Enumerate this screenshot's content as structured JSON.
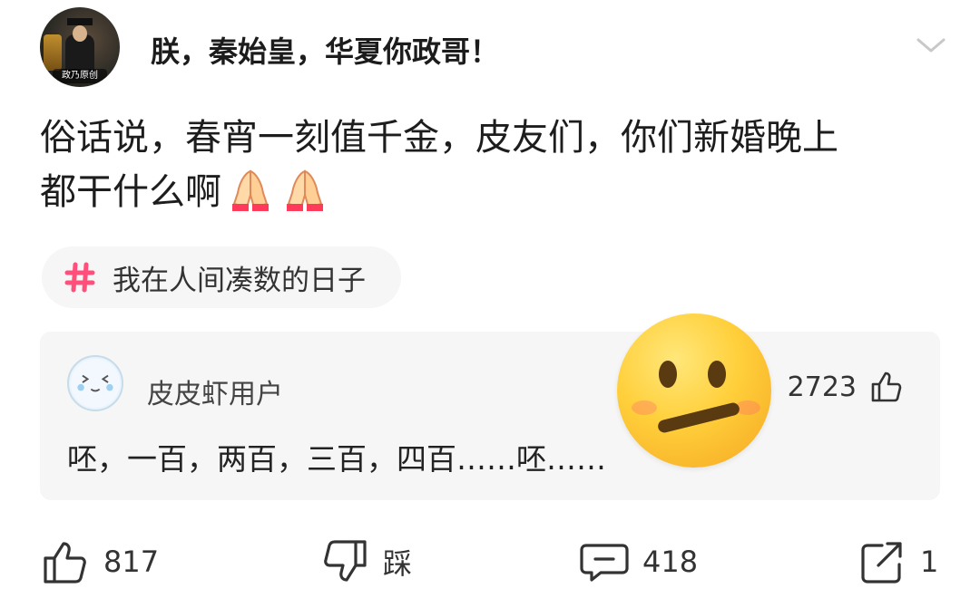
{
  "post": {
    "author": "朕，秦始皇，华夏你政哥！",
    "avatar_caption": "政乃原创",
    "text_line1": "俗话说，春宵一刻值千金，皮友们，你们新婚晚上",
    "text_line2": "都干什么啊",
    "inline_emojis": [
      "folded-hands-icon",
      "folded-hands-icon"
    ],
    "tag": "我在人间凑数的日子",
    "tag_icon": "hash-icon"
  },
  "hot_comment": {
    "user": "皮皮虾用户",
    "likes": "2723",
    "text": "呸，一百，两百，三百，四百……呸……"
  },
  "overlay_emoji": "neutral-face-emoji",
  "actions": {
    "like_count": "817",
    "dislike_label": "踩",
    "comment_count": "418",
    "share_count": "1"
  },
  "colors": {
    "tag_hash": "#ff4f7a",
    "panel_bg": "#f6f6f6",
    "text": "#222222"
  }
}
